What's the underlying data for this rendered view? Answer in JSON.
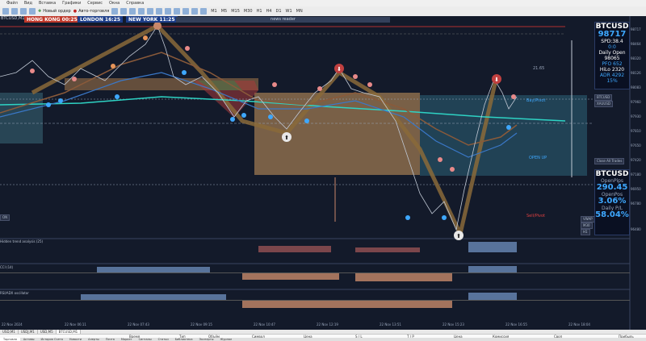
{
  "menu": [
    "Файл",
    "Вид",
    "Вставка",
    "Графики",
    "Сервис",
    "Окна",
    "Справка"
  ],
  "toolbar": {
    "new_order": "Новый ордер",
    "autotrading": "Авто-торговля",
    "timeframes": [
      "M1",
      "M5",
      "M15",
      "M30",
      "H1",
      "H4",
      "D1",
      "W1",
      "MN"
    ]
  },
  "clocks": {
    "hk": "HONG KONG 00:25",
    "london": "LONDON 16:25",
    "ny": "NEW YORK 11:25"
  },
  "news_label": "news reader",
  "symbol_tag": "BTCUSD,M1",
  "chart_buttons": {
    "b1": "BTCUSD",
    "b2": "XAUUSD",
    "close_all": "Close All Trades",
    "vwap": "VWAP",
    "m30": "M30",
    "h1": "H1"
  },
  "chart_notes": {
    "bay_pivot": "Bay/Pivot",
    "sell_pivot": "Sell/Pivot",
    "open_up": "OPEN UP",
    "v21": "21.65",
    "on": "ON"
  },
  "panel_top": {
    "symbol": "BTCUSD",
    "price": "98717",
    "spd_label": "SPD:38.4",
    "zero": "0:0",
    "daily_open_label": "Daily Open",
    "daily_open": "98065",
    "pfo": "PFO  652",
    "hilo": "HiLo 2320",
    "adr": "ADR 4292",
    "pct": "15%"
  },
  "panel_bot": {
    "symbol": "BTCUSD",
    "openpips_label": "OpenPips",
    "openpips": "290.45",
    "openpos_label": "OpenPos",
    "openpos": "3.06%",
    "dailypl_label": "Daily P/L",
    "dailypl": "58.04%"
  },
  "price_axis": [
    "98717",
    "98464",
    "98320",
    "98126",
    "98083",
    "97960",
    "97930",
    "97810",
    "97650",
    "97420",
    "97180",
    "96950",
    "96780",
    "96480"
  ],
  "time_axis": [
    "22 Nov 2024",
    "22 Nov 06:11",
    "22 Nov 07:43",
    "22 Nov 09:15",
    "22 Nov 10:47",
    "22 Nov 12:19",
    "22 Nov 13:51",
    "22 Nov 15:23",
    "22 Nov 16:55",
    "22 Nov 18:04"
  ],
  "indicators": [
    "Hidden trend analysis (25)",
    "CCI (14)",
    "RSI/ADX oscillator"
  ],
  "chart_tabs": [
    "USD,M1",
    "USDJ,M1",
    "USD,M5",
    "BTCUSD,M1"
  ],
  "trade_columns": [
    "Время",
    "Тип",
    "Объём",
    "Символ",
    "Цена",
    "S / L",
    "T / P",
    "Цена",
    "Комиссия",
    "Своп",
    "Прибыль"
  ],
  "terminal_tabs": [
    "Торговля",
    "Активы",
    "История Счета",
    "Новости",
    "Алерты",
    "Почта",
    "Маркет",
    "Сигналы",
    "Статьи",
    "Библиотека",
    "Эксперты",
    "Журнал"
  ],
  "colors": {
    "bg": "#131a2a",
    "bull": "#3ea8ff",
    "bear": "#c8876a",
    "teal": "#2ed3c4"
  }
}
